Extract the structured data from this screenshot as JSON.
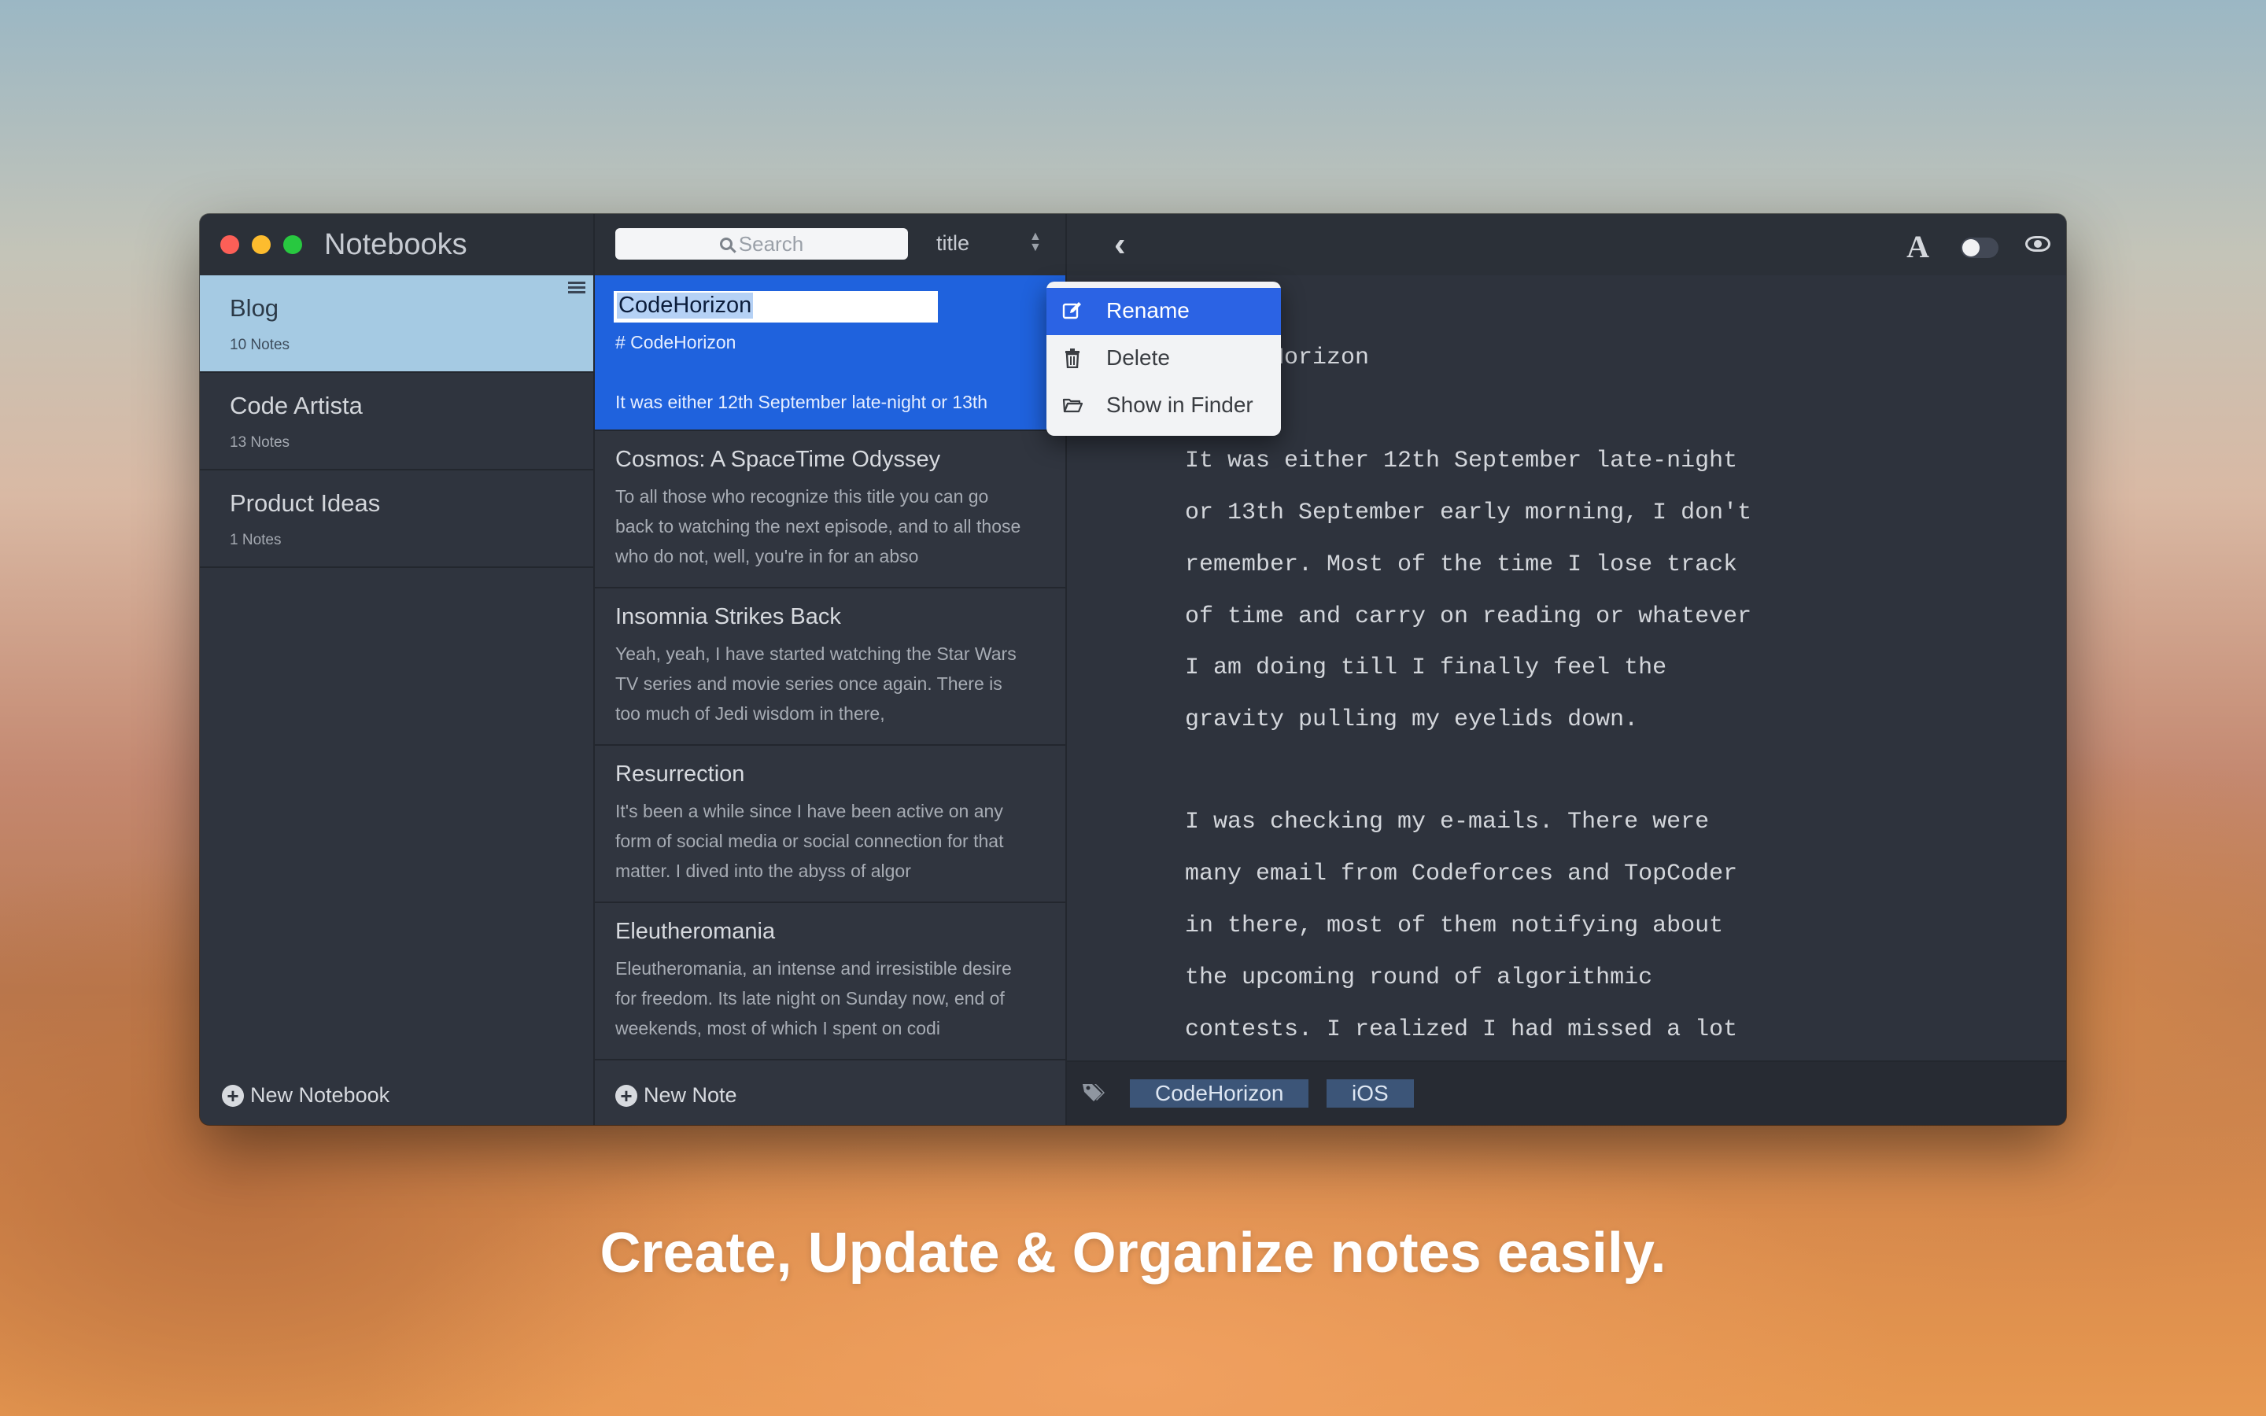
{
  "window": {
    "notebooks_title": "Notebooks"
  },
  "notebooks": {
    "items": [
      {
        "name": "Blog",
        "count": "10 Notes",
        "selected": true
      },
      {
        "name": "Code Artista",
        "count": "13 Notes",
        "selected": false
      },
      {
        "name": "Product Ideas",
        "count": "1 Notes",
        "selected": false
      }
    ],
    "new_notebook_label": "New Notebook"
  },
  "notes_toolbar": {
    "search_placeholder": "Search",
    "sort_label": "title"
  },
  "notes": {
    "items": [
      {
        "title": "CodeHorizon",
        "line1": "# CodeHorizon",
        "line2": "It was either 12th September late-night or 13th",
        "selected": true,
        "renaming": true
      },
      {
        "title": "Cosmos: A SpaceTime Odyssey",
        "preview": "To all those who recognize this title you can go back to watching the next episode, and to all those who do not, well, you're in for an abso"
      },
      {
        "title": "Insomnia Strikes Back",
        "preview": "Yeah, yeah, I have started watching the Star Wars TV series and movie series once again. There is too much of Jedi wisdom in there,"
      },
      {
        "title": "Resurrection",
        "preview": "It's been a while since I have been active on any form of social media or social connection for that matter. I dived into the abyss of algor"
      },
      {
        "title": "Eleutheromania",
        "preview": "Eleutheromania, an intense and irresistible desire for freedom. Its late night on Sunday now, end of weekends, most of which I spent on codi"
      }
    ],
    "new_note_label": "New Note"
  },
  "context_menu": {
    "items": [
      {
        "label": "Rename",
        "icon": "edit-icon",
        "active": true
      },
      {
        "label": "Delete",
        "icon": "trash-icon",
        "active": false
      },
      {
        "label": "Show in Finder",
        "icon": "folder-icon",
        "active": false
      }
    ]
  },
  "editor": {
    "heading": "CodeHorizon",
    "lines": [
      "It was either 12th September late-night",
      "or 13th September early morning, I don't",
      "remember. Most of the time I lose track",
      "of time and carry on reading or whatever",
      "I am doing till I finally feel the",
      "gravity pulling my eyelids down.",
      "",
      "I was checking my e-mails. There were",
      "many email from Codeforces and TopCoder",
      "in there, most of them notifying about",
      "the upcoming round of algorithmic",
      "contests. I realized I had missed a lot"
    ],
    "tags": [
      "CodeHorizon",
      "iOS"
    ]
  },
  "caption": "Create, Update & Organize notes easily.",
  "colors": {
    "selection_blue": "#1f62dd",
    "notebook_selected": "#a5cae3",
    "window_bg": "#2c313b",
    "menu_highlight": "#2b63e4"
  }
}
